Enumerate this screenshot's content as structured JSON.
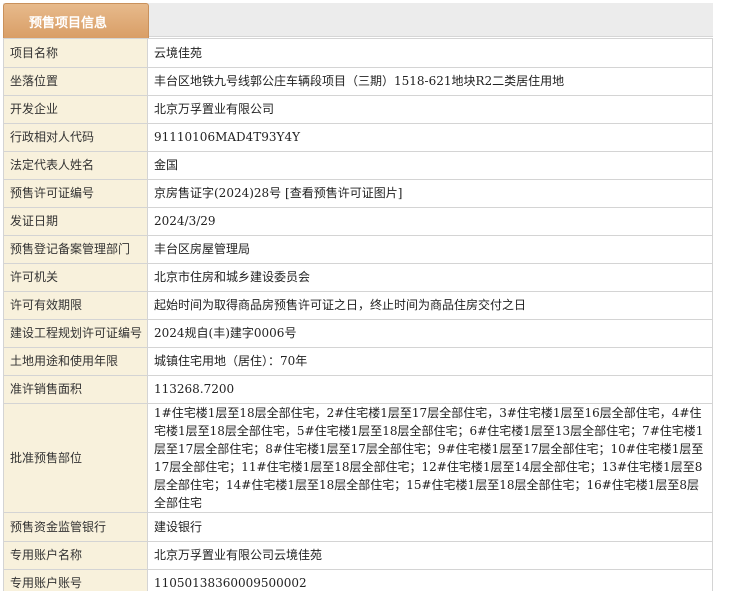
{
  "section_title": "预售项目信息",
  "rows": [
    {
      "label": "项目名称",
      "value": "云境佳苑"
    },
    {
      "label": "坐落位置",
      "value": "丰台区地铁九号线郭公庄车辆段项目（三期）1518-621地块R2二类居住用地"
    },
    {
      "label": "开发企业",
      "value": "北京万孚置业有限公司"
    },
    {
      "label": "行政相对人代码",
      "value": "91110106MAD4T93Y4Y"
    },
    {
      "label": "法定代表人姓名",
      "value": "金国"
    },
    {
      "label": "预售许可证编号",
      "value": "京房售证字(2024)28号",
      "link": "[查看预售许可证图片]"
    },
    {
      "label": "发证日期",
      "value": "2024/3/29"
    },
    {
      "label": "预售登记备案管理部门",
      "value": "丰台区房屋管理局"
    },
    {
      "label": "许可机关",
      "value": "北京市住房和城乡建设委员会"
    },
    {
      "label": "许可有效期限",
      "value": "起始时间为取得商品房预售许可证之日，终止时间为商品住房交付之日"
    },
    {
      "label": "建设工程规划许可证编号",
      "value": "2024规自(丰)建字0006号"
    },
    {
      "label": "土地用途和使用年限",
      "value": "城镇住宅用地（居住）：70年"
    },
    {
      "label": "准许销售面积",
      "value": "113268.7200"
    },
    {
      "label": "批准预售部位",
      "value": "1#住宅楼1层至18层全部住宅，2#住宅楼1层至17层全部住宅，3#住宅楼1层至16层全部住宅，4#住宅楼1层至18层全部住宅，5#住宅楼1层至18层全部住宅；6#住宅楼1层至13层全部住宅；7#住宅楼1层至17层全部住宅；8#住宅楼1层至17层全部住宅；9#住宅楼1层至17层全部住宅；10#住宅楼1层至17层全部住宅；11#住宅楼1层至18层全部住宅；12#住宅楼1层至14层全部住宅；13#住宅楼1层至8层全部住宅；14#住宅楼1层至18层全部住宅；15#住宅楼1层至18层全部住宅；16#住宅楼1层至8层全部住宅"
    },
    {
      "label": "预售资金监管银行",
      "value": "建设银行"
    },
    {
      "label": "专用账户名称",
      "value": "北京万孚置业有限公司云境佳苑"
    },
    {
      "label": "专用账户账号",
      "value": "11050138360009500002"
    }
  ]
}
